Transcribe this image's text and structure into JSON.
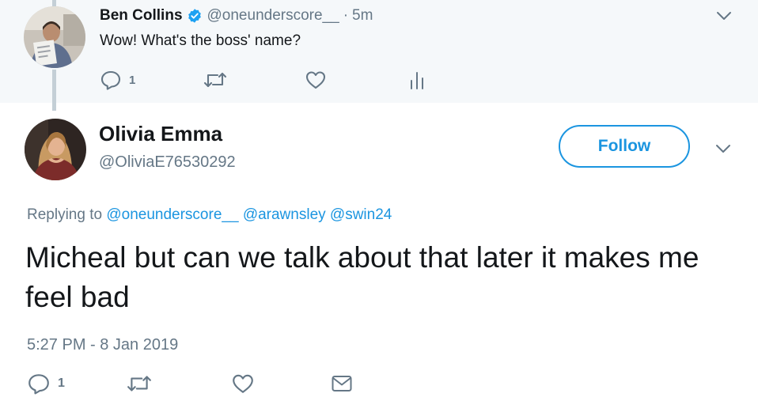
{
  "parent_tweet": {
    "author_name": "Ben Collins",
    "handle": "@oneunderscore__",
    "separator": "·",
    "time": "5m",
    "text": "Wow! What's the boss' name?",
    "reply_count": "1",
    "icons": [
      "verified-badge-icon",
      "reply-icon",
      "retweet-icon",
      "like-icon",
      "analytics-icon",
      "chevron-down-icon"
    ]
  },
  "main_tweet": {
    "author_name": "Olivia Emma",
    "handle": "@OliviaE76530292",
    "follow_label": "Follow",
    "replying_prefix": "Replying to",
    "mentions": [
      "@oneunderscore__",
      "@arawnsley",
      "@swin24"
    ],
    "text": "Micheal but can we talk about that later it makes me feel bad",
    "timestamp": "5:27 PM - 8 Jan 2019",
    "reply_count": "1",
    "icons": [
      "reply-icon",
      "retweet-icon",
      "like-icon",
      "direct-message-icon",
      "chevron-down-icon"
    ]
  },
  "colors": {
    "accent": "#1b95e0",
    "secondary_text": "#657786",
    "primary_text": "#14171a",
    "context_background": "#f5f8fa",
    "thread_line": "#c4cfd6"
  }
}
